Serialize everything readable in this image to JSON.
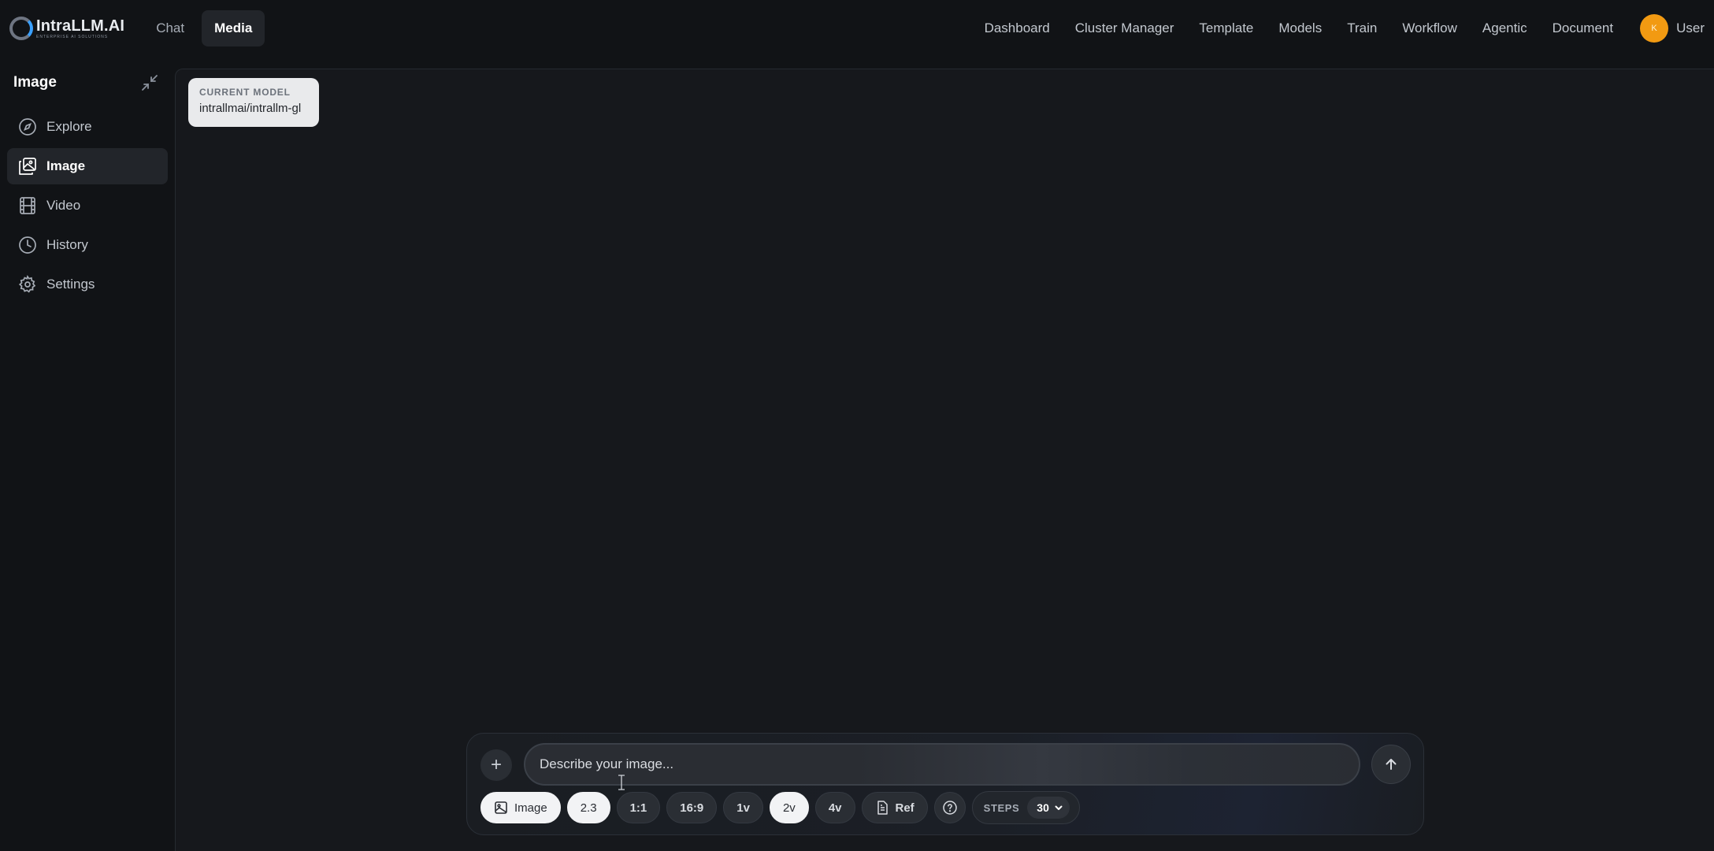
{
  "header": {
    "logo": {
      "name": "IntraLLM.AI",
      "tagline": "ENTERPRISE AI SOLUTIONS"
    },
    "tabs": [
      {
        "label": "Chat",
        "active": false
      },
      {
        "label": "Media",
        "active": true
      }
    ],
    "nav": [
      "Dashboard",
      "Cluster Manager",
      "Template",
      "Models",
      "Train",
      "Workflow",
      "Agentic",
      "Document"
    ],
    "user": {
      "avatar_initial": "K",
      "label": "User",
      "avatar_color": "#f29a12"
    }
  },
  "sidebar": {
    "title": "Image",
    "collapse_icon": "collapse-arrows-icon",
    "items": [
      {
        "label": "Explore",
        "icon": "compass-icon",
        "active": false
      },
      {
        "label": "Image",
        "icon": "image-icon",
        "active": true
      },
      {
        "label": "Video",
        "icon": "film-icon",
        "active": false
      },
      {
        "label": "History",
        "icon": "clock-icon",
        "active": false
      },
      {
        "label": "Settings",
        "icon": "gear-icon",
        "active": false
      }
    ]
  },
  "model_card": {
    "label": "CURRENT MODEL",
    "value": "intrallmai/intrallm-gl"
  },
  "composer": {
    "placeholder": "Describe your image...",
    "value": "",
    "chips": {
      "mode": "Image",
      "ratio_a": "2.3",
      "ratio_b": "1:1",
      "ratio_c": "16:9",
      "count_1": "1v",
      "count_2": "2v",
      "count_4": "4v",
      "ref": "Ref"
    },
    "steps": {
      "label": "STEPS",
      "value": "30"
    }
  }
}
